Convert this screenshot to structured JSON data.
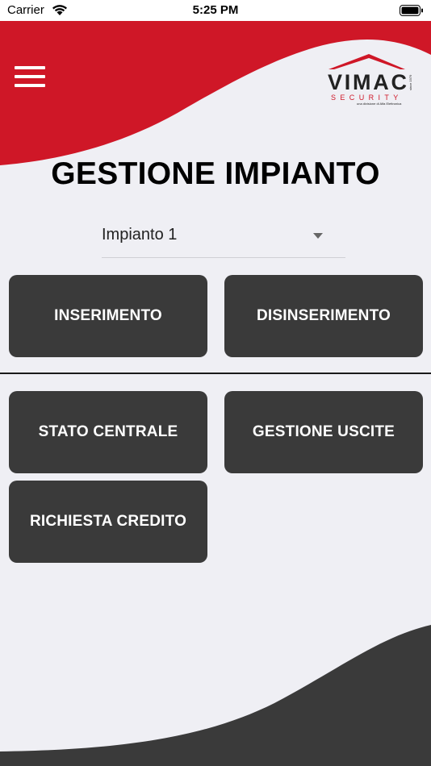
{
  "status_bar": {
    "carrier": "Carrier",
    "time": "5:25 PM"
  },
  "logo": {
    "brand": "VIMAC",
    "subtitle": "SECURITY",
    "since": "since 1979",
    "tagline": "una divisione di Alfa Elettronica"
  },
  "page": {
    "title": "GESTIONE IMPIANTO"
  },
  "selector": {
    "value": "Impianto 1"
  },
  "buttons": {
    "inserimento": "INSERIMENTO",
    "disinserimento": "DISINSERIMENTO",
    "stato_centrale": "STATO CENTRALE",
    "gestione_uscite": "GESTIONE USCITE",
    "richiesta_credito": "RICHIESTA CREDITO"
  },
  "colors": {
    "brand_red": "#cf1727",
    "button_dark": "#3a3a3a",
    "background": "#efeff4"
  },
  "icons": {
    "menu": "hamburger-menu-icon",
    "selector": "chevron-down-icon",
    "wifi": "wifi-icon",
    "battery": "battery-icon"
  }
}
